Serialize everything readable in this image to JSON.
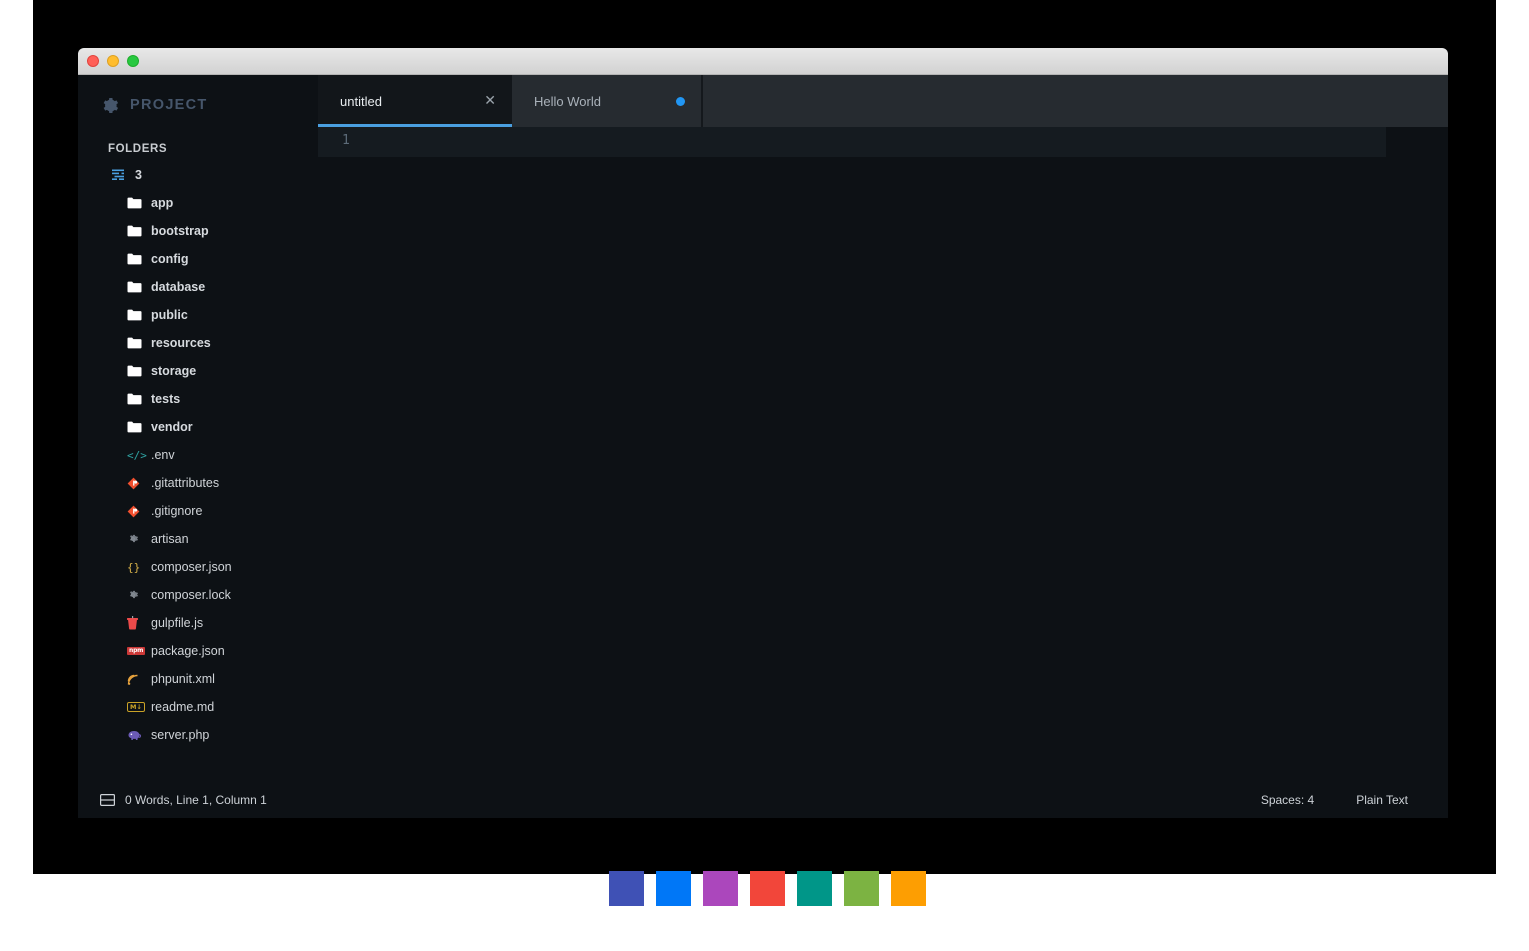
{
  "window": {
    "traffic_lights": [
      "close",
      "minimize",
      "maximize"
    ]
  },
  "sidebar": {
    "project_label": "PROJECT",
    "project_icon": "gear-icon",
    "folders_label": "FOLDERS",
    "root": {
      "label": "3",
      "icon": "tree-list-icon"
    },
    "folders": [
      {
        "label": "app",
        "icon": "folder-icon"
      },
      {
        "label": "bootstrap",
        "icon": "folder-icon"
      },
      {
        "label": "config",
        "icon": "folder-icon"
      },
      {
        "label": "database",
        "icon": "folder-icon"
      },
      {
        "label": "public",
        "icon": "folder-icon"
      },
      {
        "label": "resources",
        "icon": "folder-icon"
      },
      {
        "label": "storage",
        "icon": "folder-icon"
      },
      {
        "label": "tests",
        "icon": "folder-icon"
      },
      {
        "label": "vendor",
        "icon": "folder-icon"
      }
    ],
    "files": [
      {
        "label": ".env",
        "icon": "code-brackets-icon",
        "glyph": "</>",
        "color": "#2fa3a3"
      },
      {
        "label": ".gitattributes",
        "icon": "git-diamond-icon",
        "glyph": "◆",
        "color": "#f1502f"
      },
      {
        "label": ".gitignore",
        "icon": "git-diamond-icon",
        "glyph": "◆",
        "color": "#f1502f"
      },
      {
        "label": "artisan",
        "icon": "gear-icon",
        "glyph": "✿",
        "color": "#8a9199"
      },
      {
        "label": "composer.json",
        "icon": "curly-braces-icon",
        "glyph": "{}",
        "color": "#d8b24a"
      },
      {
        "label": "composer.lock",
        "icon": "gear-icon",
        "glyph": "✿",
        "color": "#8a9199"
      },
      {
        "label": "gulpfile.js",
        "icon": "gulp-cup-icon",
        "glyph": "▼",
        "color": "#eb4a4a"
      },
      {
        "label": "package.json",
        "icon": "npm-icon",
        "glyph": "npm",
        "color": "#cb3837"
      },
      {
        "label": "phpunit.xml",
        "icon": "rss-waves-icon",
        "glyph": "≋",
        "color": "#e8a33d"
      },
      {
        "label": "readme.md",
        "icon": "markdown-icon",
        "glyph": "M↓",
        "color": "#c9a227"
      },
      {
        "label": "server.php",
        "icon": "php-elephant-icon",
        "glyph": "◓",
        "color": "#6b5bb5"
      }
    ]
  },
  "tabs": [
    {
      "label": "untitled",
      "active": true,
      "close_icon": "close-icon",
      "close_glyph": "✕",
      "dirty": false
    },
    {
      "label": "Hello World",
      "active": false,
      "dirty": true,
      "dirty_icon": "unsaved-dot-icon"
    }
  ],
  "editor": {
    "line_numbers": [
      "1"
    ],
    "content": ""
  },
  "statusbar": {
    "panel_icon": "layout-panel-icon",
    "position_text": "0 Words, Line 1, Column 1",
    "indentation": "Spaces: 4",
    "syntax": "Plain Text"
  },
  "swatches": [
    {
      "name": "indigo",
      "color": "#3f51b5"
    },
    {
      "name": "blue",
      "color": "#0077f7"
    },
    {
      "name": "purple",
      "color": "#ab47bc"
    },
    {
      "name": "red",
      "color": "#f2463a"
    },
    {
      "name": "teal",
      "color": "#009688"
    },
    {
      "name": "green",
      "color": "#7cb342"
    },
    {
      "name": "orange",
      "color": "#fd9e02"
    }
  ],
  "colors": {
    "accent_blue": "#4a9fe0",
    "editor_bg": "#0d1115",
    "tabbar_bg": "#262b30",
    "project_label": "#46566b"
  }
}
